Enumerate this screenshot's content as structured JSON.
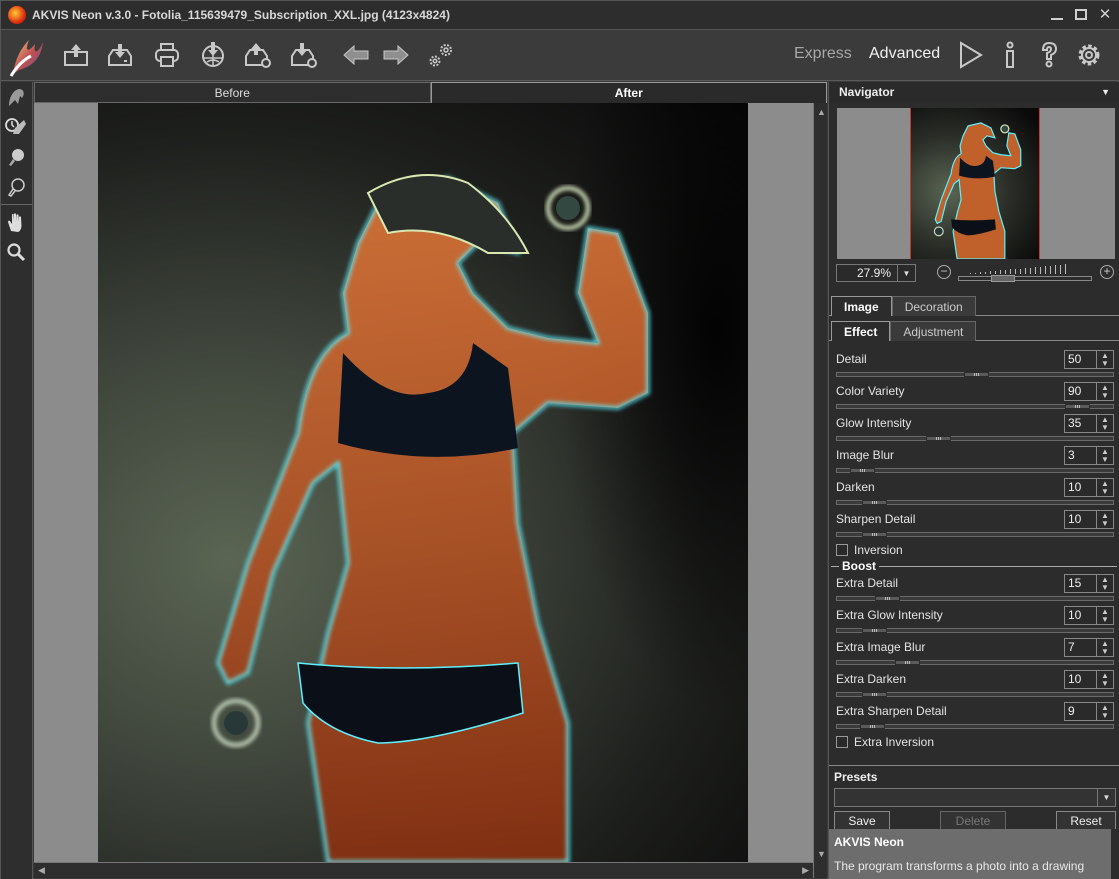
{
  "window": {
    "title": "AKVIS Neon v.3.0 - Fotolia_115639479_Subscription_XXL.jpg (4123x4824)",
    "controls": [
      "minimize",
      "maximize",
      "close"
    ]
  },
  "toolbar": {
    "buttons": [
      {
        "name": "open-image",
        "icon": "open-icon"
      },
      {
        "name": "save-image",
        "icon": "save-icon"
      },
      {
        "name": "print",
        "icon": "print-icon"
      },
      {
        "name": "share",
        "icon": "share-globe-icon"
      },
      {
        "name": "batch-open",
        "icon": "batch-open-icon"
      },
      {
        "name": "batch-save",
        "icon": "batch-save-icon"
      },
      {
        "name": "undo",
        "icon": "arrow-left-icon"
      },
      {
        "name": "redo",
        "icon": "arrow-right-icon"
      },
      {
        "name": "batch-processing",
        "icon": "gears-icon"
      }
    ],
    "mode_express": "Express",
    "mode_advanced": "Advanced",
    "active_mode": "Advanced",
    "right_icons": [
      "run-icon",
      "info-icon",
      "help-icon",
      "settings-icon"
    ]
  },
  "left_tools": [
    "brush-icon",
    "history-brush-icon",
    "glow-bulb-icon",
    "bulb-outline-icon",
    "hand-icon",
    "zoom-icon"
  ],
  "canvas": {
    "tabs": [
      {
        "label": "Before",
        "active": false
      },
      {
        "label": "After",
        "active": true
      }
    ]
  },
  "navigator": {
    "title": "Navigator",
    "zoom": "27.9%"
  },
  "panel": {
    "main_tabs": [
      {
        "label": "Image",
        "active": true
      },
      {
        "label": "Decoration",
        "active": false
      }
    ],
    "sub_tabs": [
      {
        "label": "Effect",
        "active": true
      },
      {
        "label": "Adjustment",
        "active": false
      }
    ],
    "params": [
      {
        "label": "Detail",
        "value": "50",
        "fraction": 0.5
      },
      {
        "label": "Color Variety",
        "value": "90",
        "fraction": 0.9
      },
      {
        "label": "Glow Intensity",
        "value": "35",
        "fraction": 0.35
      },
      {
        "label": "Image Blur",
        "value": "3",
        "fraction": 0.05
      },
      {
        "label": "Darken",
        "value": "10",
        "fraction": 0.1
      },
      {
        "label": "Sharpen Detail",
        "value": "10",
        "fraction": 0.1
      }
    ],
    "inversion": {
      "label": "Inversion",
      "checked": false
    },
    "boost_title": "Boost",
    "boost_params": [
      {
        "label": "Extra Detail",
        "value": "15",
        "fraction": 0.15
      },
      {
        "label": "Extra Glow Intensity",
        "value": "10",
        "fraction": 0.1
      },
      {
        "label": "Extra Image Blur",
        "value": "7",
        "fraction": 0.23
      },
      {
        "label": "Extra Darken",
        "value": "10",
        "fraction": 0.1
      },
      {
        "label": "Extra Sharpen Detail",
        "value": "9",
        "fraction": 0.09
      }
    ],
    "extra_inversion": {
      "label": "Extra Inversion",
      "checked": false
    }
  },
  "presets": {
    "title": "Presets",
    "selected": "",
    "save_label": "Save",
    "delete_label": "Delete",
    "reset_label": "Reset"
  },
  "help": {
    "title": "AKVIS Neon",
    "text": "The program transforms a photo into a drawing"
  }
}
